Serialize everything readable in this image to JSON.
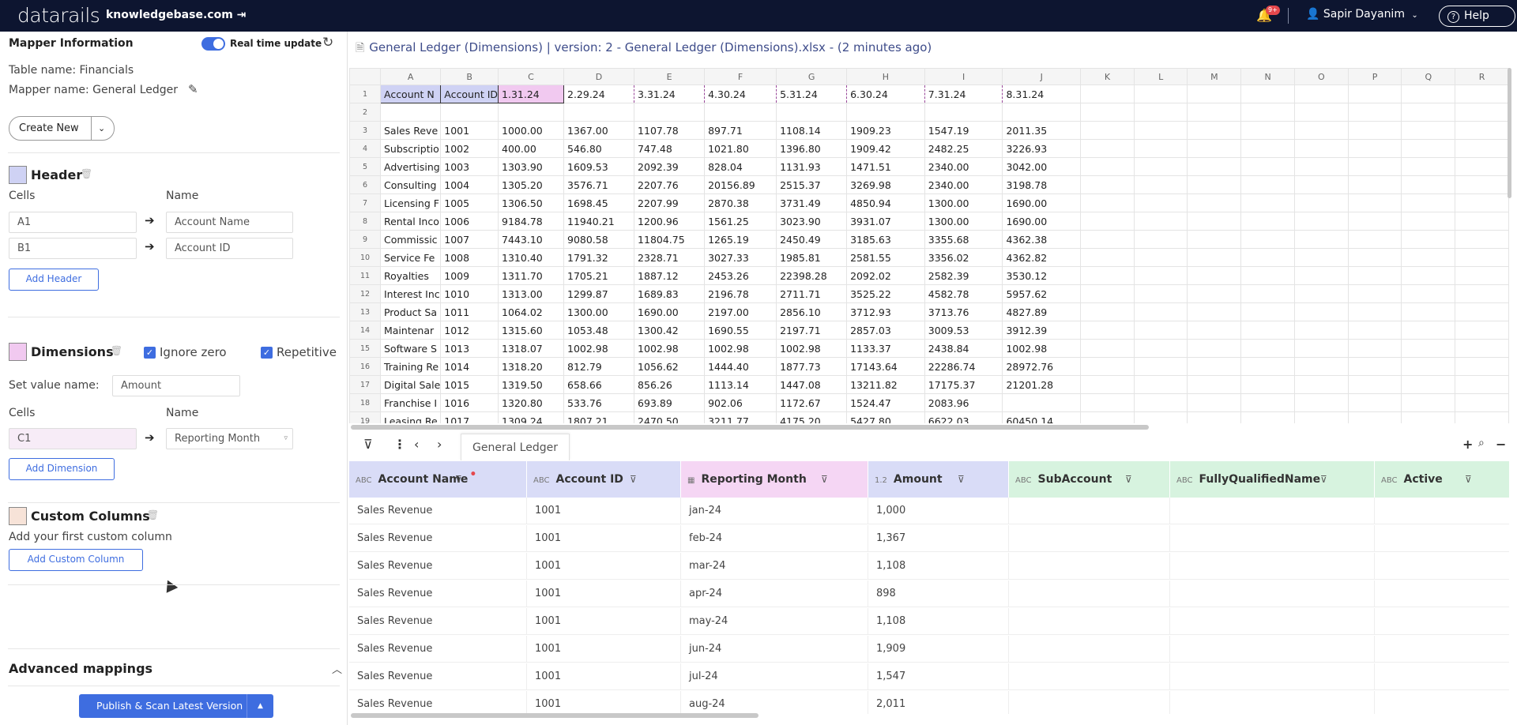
{
  "topbar": {
    "logo": "datarails",
    "domain": "knowledgebase.com",
    "notif_badge": "9+",
    "user": "Sapir Dayanim",
    "help": "Help",
    "bg_color": "#0d1530"
  },
  "left": {
    "title": "Mapper Information",
    "realtime_label": "Real time update",
    "table_name": "Table name: Financials",
    "mapper_name": "Mapper name: General Ledger",
    "create_new": "Create New",
    "header": {
      "title": "Header",
      "cells_label": "Cells",
      "name_label": "Name",
      "rows": [
        {
          "cell": "A1",
          "name": "Account Name"
        },
        {
          "cell": "B1",
          "name": "Account ID"
        }
      ],
      "add_button": "Add Header"
    },
    "dimensions": {
      "title": "Dimensions",
      "ignore_zero": "Ignore zero",
      "repetitive": "Repetitive",
      "set_value_label": "Set value name:",
      "set_value": "Amount",
      "cells_label": "Cells",
      "name_label": "Name",
      "cell": "C1",
      "name": "Reporting Month",
      "add_button": "Add Dimension"
    },
    "custom": {
      "title": "Custom Columns",
      "hint": "Add your first custom column",
      "add_button": "Add Custom Column"
    },
    "advanced": "Advanced mappings",
    "publish": "Publish & Scan Latest Version"
  },
  "file_title": "General Ledger (Dimensions) | version: 2 - General Ledger (Dimensions).xlsx - (2 minutes ago)",
  "sheet": {
    "columns": [
      "A",
      "B",
      "C",
      "D",
      "E",
      "F",
      "G",
      "H",
      "I",
      "J",
      "K",
      "L",
      "M",
      "N",
      "O",
      "P",
      "Q",
      "R"
    ],
    "row1": [
      "Account N",
      "Account ID",
      "1.31.24",
      "2.29.24",
      "3.31.24",
      "4.30.24",
      "5.31.24",
      "6.30.24",
      "7.31.24",
      "8.31.24"
    ],
    "rows": [
      [
        "Sales Reve",
        "1001",
        "1000.00",
        "1367.00",
        "1107.78",
        "897.71",
        "1108.14",
        "1909.23",
        "1547.19",
        "2011.35"
      ],
      [
        "Subscriptio",
        "1002",
        "400.00",
        "546.80",
        "747.48",
        "1021.80",
        "1396.80",
        "1909.42",
        "2482.25",
        "3226.93"
      ],
      [
        "Advertising",
        "1003",
        "1303.90",
        "1609.53",
        "2092.39",
        "828.04",
        "1131.93",
        "1471.51",
        "2340.00",
        "3042.00"
      ],
      [
        "Consulting",
        "1004",
        "1305.20",
        "3576.71",
        "2207.76",
        "20156.89",
        "2515.37",
        "3269.98",
        "2340.00",
        "3198.78"
      ],
      [
        "Licensing F",
        "1005",
        "1306.50",
        "1698.45",
        "2207.99",
        "2870.38",
        "3731.49",
        "4850.94",
        "1300.00",
        "1690.00"
      ],
      [
        "Rental Inco",
        "1006",
        "9184.78",
        "11940.21",
        "1200.96",
        "1561.25",
        "3023.90",
        "3931.07",
        "1300.00",
        "1690.00"
      ],
      [
        "Commissic",
        "1007",
        "7443.10",
        "9080.58",
        "11804.75",
        "1265.19",
        "2450.49",
        "3185.63",
        "3355.68",
        "4362.38"
      ],
      [
        "Service Fe",
        "1008",
        "1310.40",
        "1791.32",
        "2328.71",
        "3027.33",
        "1985.81",
        "2581.55",
        "3356.02",
        "4362.82"
      ],
      [
        "Royalties",
        "1009",
        "1311.70",
        "1705.21",
        "1887.12",
        "2453.26",
        "22398.28",
        "2092.02",
        "2582.39",
        "3530.12"
      ],
      [
        "Interest Inc",
        "1010",
        "1313.00",
        "1299.87",
        "1689.83",
        "2196.78",
        "2711.71",
        "3525.22",
        "4582.78",
        "5957.62"
      ],
      [
        "Product Sa",
        "1011",
        "1064.02",
        "1300.00",
        "1690.00",
        "2197.00",
        "2856.10",
        "3712.93",
        "3713.76",
        "4827.89"
      ],
      [
        "Maintenar",
        "1012",
        "1315.60",
        "1053.48",
        "1300.42",
        "1690.55",
        "2197.71",
        "2857.03",
        "3009.53",
        "3912.39"
      ],
      [
        "Software S",
        "1013",
        "1318.07",
        "1002.98",
        "1002.98",
        "1002.98",
        "1002.98",
        "1133.37",
        "2438.84",
        "1002.98"
      ],
      [
        "Training Re",
        "1014",
        "1318.20",
        "812.79",
        "1056.62",
        "1444.40",
        "1877.73",
        "17143.64",
        "22286.74",
        "28972.76"
      ],
      [
        "Digital Sale",
        "1015",
        "1319.50",
        "658.66",
        "856.26",
        "1113.14",
        "1447.08",
        "13211.82",
        "17175.37",
        "21201.28"
      ],
      [
        "Franchise I",
        "1016",
        "1320.80",
        "533.76",
        "693.89",
        "902.06",
        "1172.67",
        "1524.47",
        "2083.96",
        ""
      ],
      [
        "Leasing Re",
        "1017",
        "1309.24",
        "1807.21",
        "2470.50",
        "3211.77",
        "4175.20",
        "5427.80",
        "6622.03",
        "60450.14"
      ]
    ]
  },
  "grid_tab": "General Ledger",
  "grid": {
    "columns": [
      {
        "label": "Account Name",
        "type": "text",
        "color": "#d9dcf7",
        "required": true
      },
      {
        "label": "Account ID",
        "type": "text",
        "color": "#d9dcf7"
      },
      {
        "label": "Reporting Month",
        "type": "date",
        "color": "#f5d6f4"
      },
      {
        "label": "Amount",
        "type": "number",
        "color": "#d9dcf7"
      },
      {
        "label": "SubAccount",
        "type": "text",
        "color": "#d7f3df"
      },
      {
        "label": "FullyQualifiedName",
        "type": "text",
        "color": "#d7f3df"
      },
      {
        "label": "Active",
        "type": "text",
        "color": "#d7f3df"
      }
    ],
    "type_icons": {
      "text": "ABC",
      "number": "1.2",
      "date": "▦"
    },
    "rows": [
      [
        "Sales Revenue",
        "1001",
        "jan-24",
        "1,000"
      ],
      [
        "Sales Revenue",
        "1001",
        "feb-24",
        "1,367"
      ],
      [
        "Sales Revenue",
        "1001",
        "mar-24",
        "1,108"
      ],
      [
        "Sales Revenue",
        "1001",
        "apr-24",
        "898"
      ],
      [
        "Sales Revenue",
        "1001",
        "may-24",
        "1,108"
      ],
      [
        "Sales Revenue",
        "1001",
        "jun-24",
        "1,909"
      ],
      [
        "Sales Revenue",
        "1001",
        "jul-24",
        "1,547"
      ],
      [
        "Sales Revenue",
        "1001",
        "aug-24",
        "2,011"
      ]
    ]
  }
}
